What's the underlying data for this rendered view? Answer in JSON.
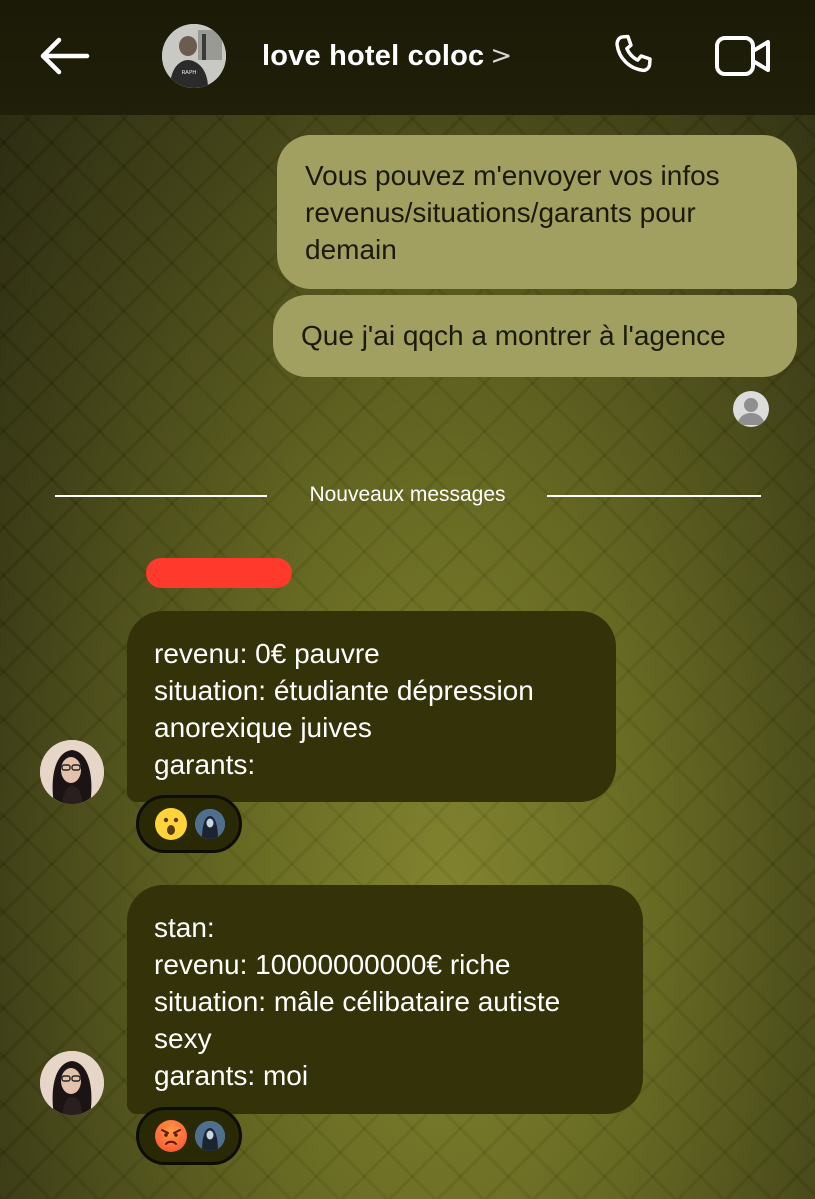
{
  "header": {
    "title": "love hotel coloc",
    "title_chevron": ">",
    "back_icon": "arrow-left-icon",
    "call_icon": "phone-icon",
    "video_icon": "video-camera-icon",
    "group_avatar_caption": "RAPH"
  },
  "messages_out": [
    {
      "text": "Vous pouvez m'envoyer vos infos\nrevenus/situations/garants pour\ndemain"
    },
    {
      "text": "Que j'ai qqch a montrer à l'agence"
    }
  ],
  "divider": {
    "label": "Nouveaux messages"
  },
  "messages_in": [
    {
      "text": "revenu: 0€ pauvre\nsituation: étudiante dépression\nanorexique juives\ngarants:",
      "reaction": "astonished-face-emoji"
    },
    {
      "text": "stan:\nrevenu: 10000000000€ riche\nsituation: mâle célibataire autiste\nsexy\ngarants: moi",
      "reaction": "angry-face-emoji"
    }
  ],
  "colors": {
    "outgoing_bubble": "#a2a061",
    "incoming_bubble": "#333208",
    "redaction": "#ff3a2c"
  }
}
